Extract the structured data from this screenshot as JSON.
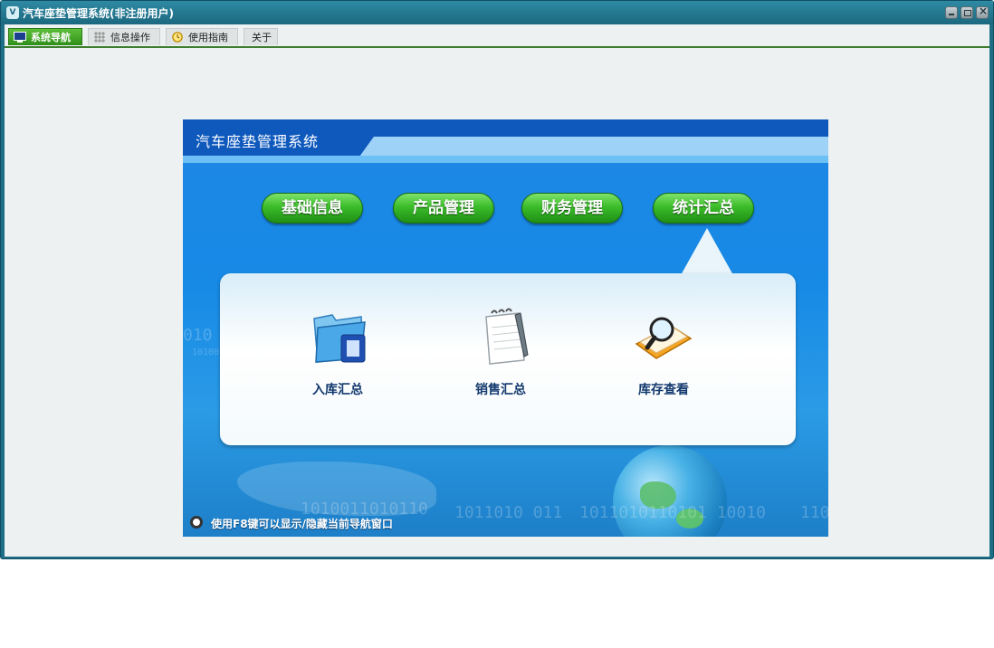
{
  "window": {
    "title": "汽车座垫管理系统(非注册用户)",
    "app_icon": "vf-icon"
  },
  "tabs": [
    {
      "label": "系统导航",
      "icon": "monitor-icon",
      "active": true
    },
    {
      "label": "信息操作",
      "icon": "grid-icon",
      "active": false
    },
    {
      "label": "使用指南",
      "icon": "clock-icon",
      "active": false
    },
    {
      "label": "关于",
      "icon": "",
      "active": false
    }
  ],
  "panel": {
    "title": "汽车座垫管理系统",
    "menu_buttons": [
      "基础信息",
      "产品管理",
      "财务管理",
      "统计汇总"
    ],
    "selected_menu": "统计汇总",
    "features": [
      {
        "label": "入库汇总",
        "icon": "folder-document-icon"
      },
      {
        "label": "销售汇总",
        "icon": "notepad-pen-icon"
      },
      {
        "label": "库存查看",
        "icon": "magnifier-book-icon"
      }
    ],
    "background_binary": [
      "010",
      "10100",
      "1010011010110",
      "1011010  011",
      "1011010110101  10010",
      "110"
    ],
    "hint": "使用F8键可以显示/隐藏当前导航窗口"
  },
  "colors": {
    "titlebar": "#1b6880",
    "accent_green": "#3cbc2a",
    "panel_blue": "#178ae6",
    "banner_dark": "#0f59bd"
  }
}
